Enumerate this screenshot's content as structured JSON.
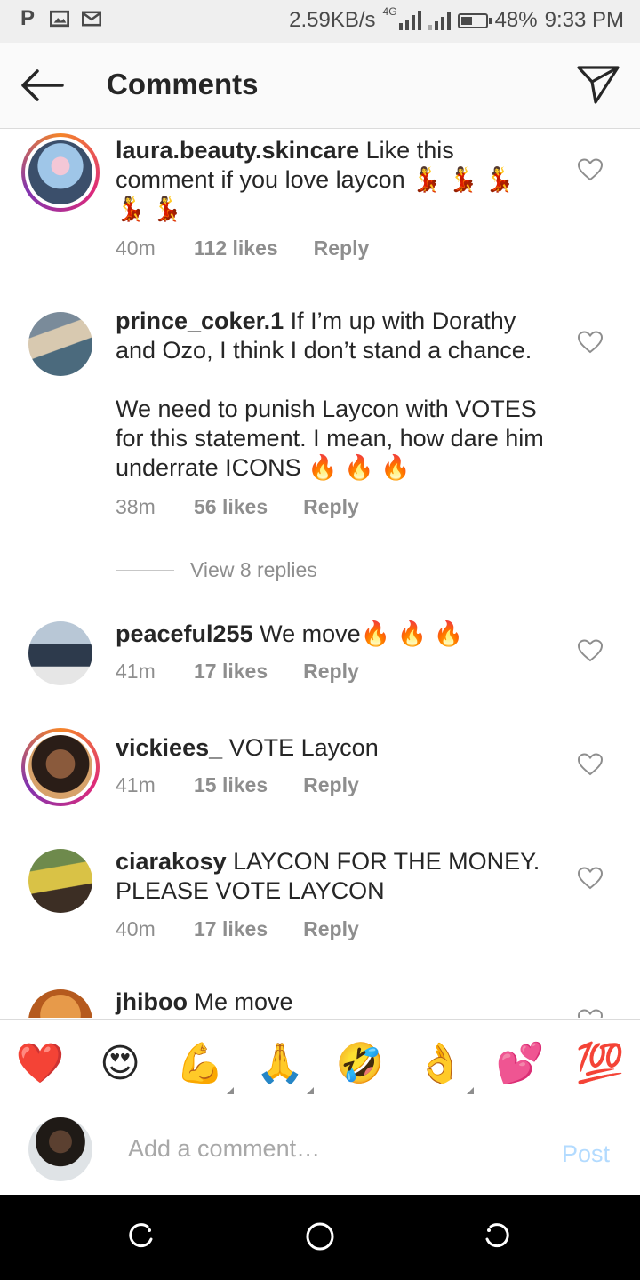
{
  "status_bar": {
    "left_icons": [
      "p-icon",
      "image-icon",
      "gmail-icon"
    ],
    "net_speed": "2.59KB/s",
    "network_type": "4G",
    "battery_percent": "48%",
    "battery_level": 0.48,
    "time": "9:33 PM"
  },
  "header": {
    "title": "Comments",
    "back_icon": "arrow-left-icon",
    "share_icon": "send-icon"
  },
  "comments": [
    {
      "username": "laura.beauty.skincare",
      "text": "Like this comment if you love laycon 💃 💃 💃 💃 💃",
      "time": "40m",
      "likes": "112 likes",
      "reply": "Reply",
      "story_ring": true
    },
    {
      "username": "prince_coker.1",
      "text": "If I’m up with Dorathy and Ozo, I think I don’t stand a chance.\n\nWe need to punish Laycon with VOTES for this statement. I mean, how dare him underrate ICONS 🔥 🔥 🔥",
      "time": "38m",
      "likes": "56 likes",
      "reply": "Reply",
      "story_ring": false
    },
    {
      "username": "peaceful255",
      "text": "We move🔥 🔥 🔥",
      "time": "41m",
      "likes": "17 likes",
      "reply": "Reply",
      "story_ring": false
    },
    {
      "username": "vickiees_",
      "text": "VOTE Laycon",
      "time": "41m",
      "likes": "15 likes",
      "reply": "Reply",
      "story_ring": true
    },
    {
      "username": "ciarakosy",
      "text": "LAYCON FOR THE MONEY. PLEASE VOTE LAYCON",
      "time": "40m",
      "likes": "17 likes",
      "reply": "Reply",
      "story_ring": false
    },
    {
      "username": "jhiboo",
      "text": "Me move",
      "story_ring": false
    }
  ],
  "view_replies": "View 8 replies",
  "emoji_bar": [
    "❤️",
    "😍",
    "💪",
    "🙏",
    "🤣",
    "👌",
    "💕",
    "💯"
  ],
  "compose": {
    "placeholder": "Add a comment…",
    "post_label": "Post"
  },
  "nav_bar": [
    "recent-apps-icon",
    "home-icon",
    "back-icon"
  ],
  "colors": {
    "link_blue_disabled": "#b3dbff",
    "meta_gray": "#8e8e8e",
    "text_dark": "#262626"
  }
}
